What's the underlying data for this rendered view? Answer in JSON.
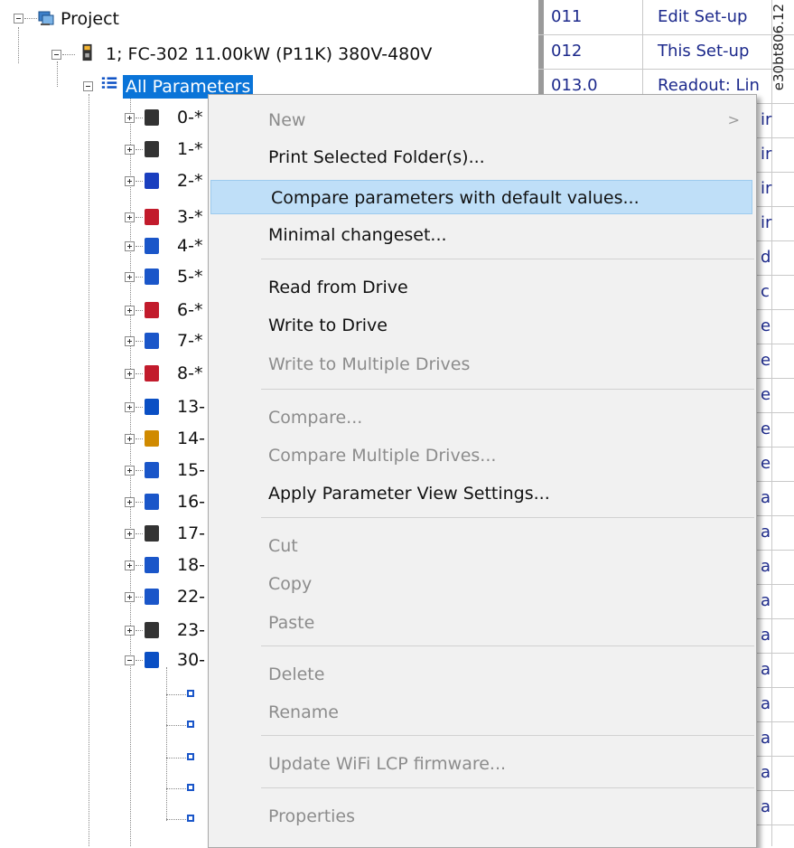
{
  "tree": {
    "project_label": "Project",
    "drive_label": "1; FC-302 11.00kW (P11K) 380V-480V",
    "all_parameters_label": "All Parameters",
    "groups": [
      "0-*",
      "1-*",
      "2-*",
      "3-*",
      "4-*",
      "5-*",
      "6-*",
      "7-*",
      "8-*",
      "13-",
      "14-",
      "15-",
      "16-",
      "17-",
      "18-",
      "22-",
      "23-",
      "30-"
    ]
  },
  "table": {
    "rows": [
      {
        "id": "011",
        "name": "Edit Set-up"
      },
      {
        "id": "012",
        "name": "This Set-up"
      },
      {
        "id": "013.0",
        "name": "Readout: Lin"
      }
    ],
    "right_fragments": [
      "ir",
      "ir",
      "ir",
      "ir",
      "d",
      "c",
      "e",
      "e",
      "e",
      "e",
      "e",
      "a",
      "a",
      "a",
      "a",
      "a",
      "a",
      "a",
      "a",
      "a",
      "a"
    ]
  },
  "menu": {
    "items": [
      {
        "label": "New",
        "enabled": false,
        "submenu": true
      },
      {
        "label": "Print Selected Folder(s)...",
        "enabled": true
      },
      {
        "label": "Compare parameters with default values...",
        "enabled": true,
        "highlighted": true
      },
      {
        "label": "Minimal changeset...",
        "enabled": true
      },
      {
        "label": "Read from Drive",
        "enabled": true
      },
      {
        "label": "Write to Drive",
        "enabled": true
      },
      {
        "label": "Write to Multiple Drives",
        "enabled": false
      },
      {
        "label": "Compare...",
        "enabled": false
      },
      {
        "label": "Compare Multiple Drives...",
        "enabled": false
      },
      {
        "label": "Apply Parameter View Settings...",
        "enabled": true
      },
      {
        "label": "Cut",
        "enabled": false
      },
      {
        "label": "Copy",
        "enabled": false
      },
      {
        "label": "Paste",
        "enabled": false
      },
      {
        "label": "Delete",
        "enabled": false
      },
      {
        "label": "Rename",
        "enabled": false
      },
      {
        "label": "Update WiFi LCP firmware...",
        "enabled": false
      },
      {
        "label": "Properties",
        "enabled": false
      }
    ],
    "submenu_arrow": ">"
  },
  "figure_id": "e30bt806.12",
  "colors": {
    "highlight": "#bfdff8",
    "selection": "#0a74d8",
    "table_text": "#1d2a8c"
  }
}
